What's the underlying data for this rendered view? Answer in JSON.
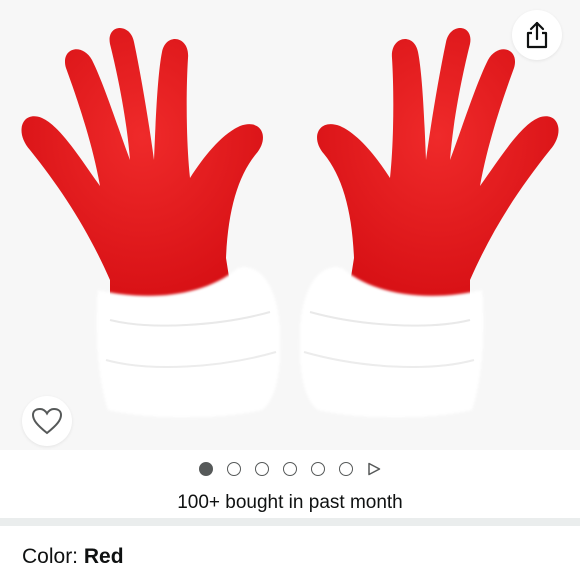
{
  "product": {
    "image_alt": "Red gloves with white faux fur cuffs",
    "gallery": {
      "image_count": 6,
      "active_index": 0,
      "has_video": true
    }
  },
  "icons": {
    "share": "share-icon",
    "wishlist": "heart-outline-icon",
    "video": "play-triangle-icon"
  },
  "social_proof": {
    "text": "100+ bought in past month"
  },
  "variant": {
    "label": "Color: ",
    "value": "Red"
  },
  "colors": {
    "glove_red": "#e4141b",
    "fur_white": "#ffffff",
    "dot_gray": "#565959",
    "text": "#0f1111"
  }
}
